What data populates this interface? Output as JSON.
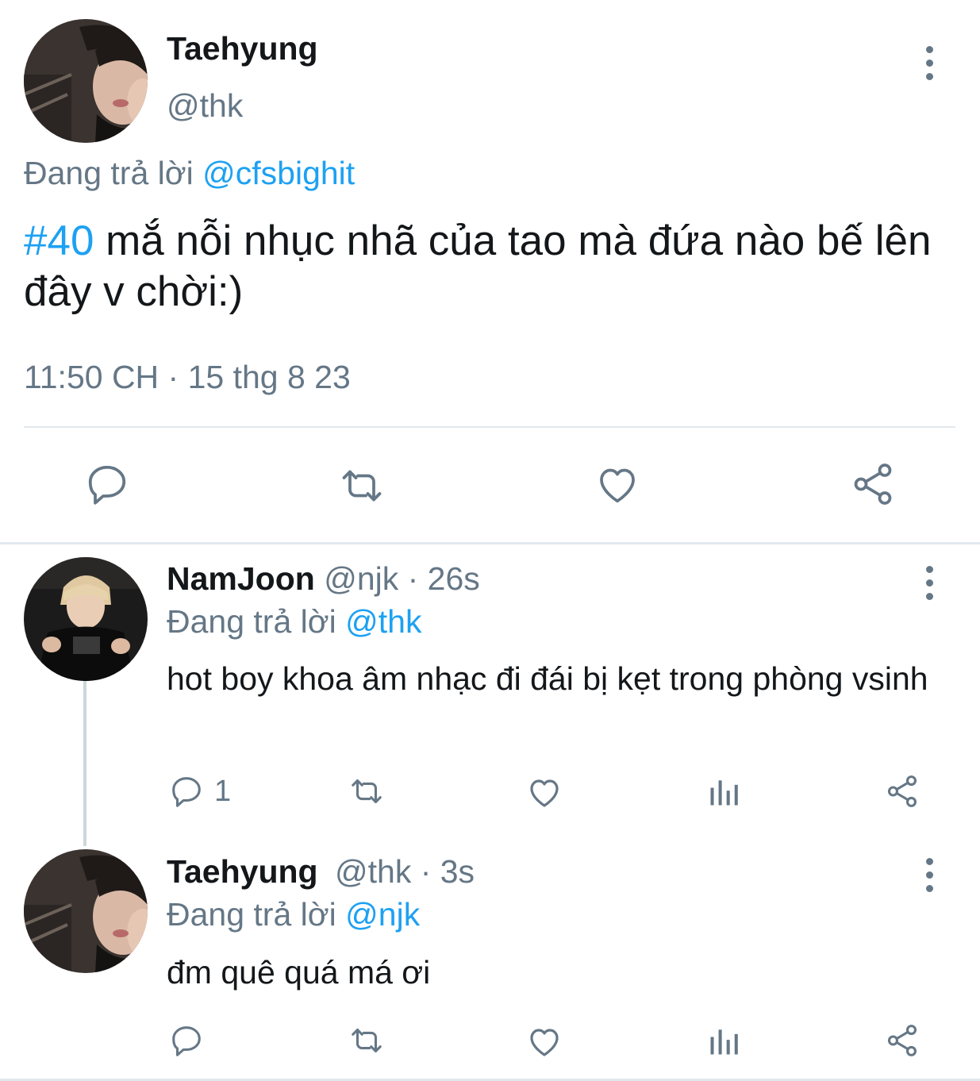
{
  "main_tweet": {
    "display_name": "Taehyung",
    "handle": "@thk",
    "replying_prefix": "Đang trả lời",
    "replying_to": "@cfsbighit",
    "hashtag": "#40",
    "text": " mắ nỗi nhục nhã của tao mà đứa nào bế lên đây v chời:)",
    "timestamp": "11:50 CH · 15 thg 8 23"
  },
  "replies": [
    {
      "display_name": "NamJoon",
      "meta": "@njk · 26s",
      "replying_prefix": "Đang trả lời",
      "replying_to": "@thk",
      "text": "hot boy khoa âm nhạc đi đái bị kẹt trong phòng vsinh",
      "reply_count": "1"
    },
    {
      "display_name": "Taehyung",
      "meta": "@thk · 3s",
      "replying_prefix": "Đang trả lời",
      "replying_to": "@njk",
      "text": "đm quê quá má ơi",
      "reply_count": ""
    }
  ],
  "icons": [
    "more-vertical-icon",
    "reply-icon",
    "retweet-icon",
    "like-icon",
    "analytics-icon",
    "share-icon"
  ],
  "colors": {
    "accent": "#1da1f2",
    "secondary_text": "#657786",
    "divider": "#e1e8ed"
  }
}
